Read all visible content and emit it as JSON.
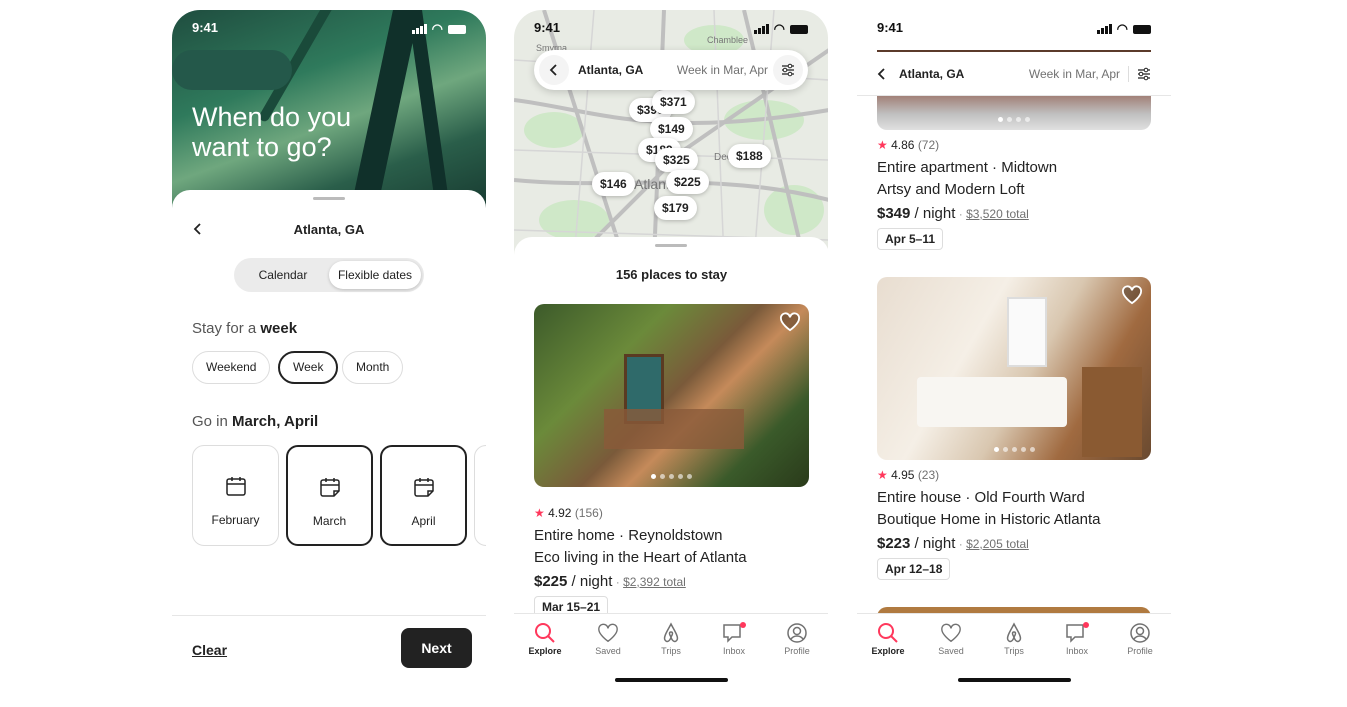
{
  "status_time": "9:41",
  "screen1": {
    "hero_title_line1": "When do you",
    "hero_title_line2": "want to go?",
    "location": "Atlanta, GA",
    "toggle": [
      "Calendar",
      "Flexible dates"
    ],
    "toggle_selected": "Flexible dates",
    "stay_prefix": "Stay for a ",
    "stay_value": "week",
    "durations": [
      "Weekend",
      "Week",
      "Month"
    ],
    "duration_selected": "Week",
    "go_prefix": "Go in ",
    "go_value": "March, April",
    "months": [
      "February",
      "March",
      "April"
    ],
    "months_selected": [
      "March",
      "April"
    ],
    "clear_label": "Clear",
    "next_label": "Next"
  },
  "screen2": {
    "search_location": "Atlanta, GA",
    "search_dates": "Week in Mar, Apr",
    "map_labels": [
      "Chamblee",
      "Smyrna",
      "Atlanta",
      "Decatur"
    ],
    "map_prices": [
      "$371",
      "$390",
      "$149",
      "$189",
      "$325",
      "$188",
      "$146",
      "$225",
      "$179"
    ],
    "places_count": "156 places to stay",
    "listing": {
      "rating": "4.92",
      "reviews": "(156)",
      "type": "Entire home · Reynoldstown",
      "title": "Eco living in the Heart of Atlanta",
      "price": "$225",
      "per": " / night",
      "sep": " · ",
      "total": "$2,392 total",
      "dates": "Mar 15–21"
    }
  },
  "screen3": {
    "location": "Atlanta, GA",
    "dates": "Week in Mar, Apr",
    "listings": [
      {
        "rating": "4.86",
        "reviews": "(72)",
        "type": "Entire apartment · Midtown",
        "title": "Artsy and Modern Loft",
        "price": "$349",
        "per": " / night",
        "sep": " · ",
        "total": "$3,520 total",
        "dates": "Apr 5–11"
      },
      {
        "rating": "4.95",
        "reviews": "(23)",
        "type": "Entire house · Old Fourth Ward",
        "title": "Boutique Home in Historic Atlanta",
        "price": "$223",
        "per": " / night",
        "sep": " · ",
        "total": "$2,205 total",
        "dates": "Apr 12–18"
      }
    ]
  },
  "tabs": [
    {
      "label": "Explore",
      "icon": "search-icon"
    },
    {
      "label": "Saved",
      "icon": "heart-icon"
    },
    {
      "label": "Trips",
      "icon": "airbnb-logo-icon"
    },
    {
      "label": "Inbox",
      "icon": "message-icon"
    },
    {
      "label": "Profile",
      "icon": "profile-icon"
    }
  ],
  "colors": {
    "accent": "#ff385c",
    "text": "#222222",
    "muted": "#717171",
    "next_button": "#222222"
  }
}
